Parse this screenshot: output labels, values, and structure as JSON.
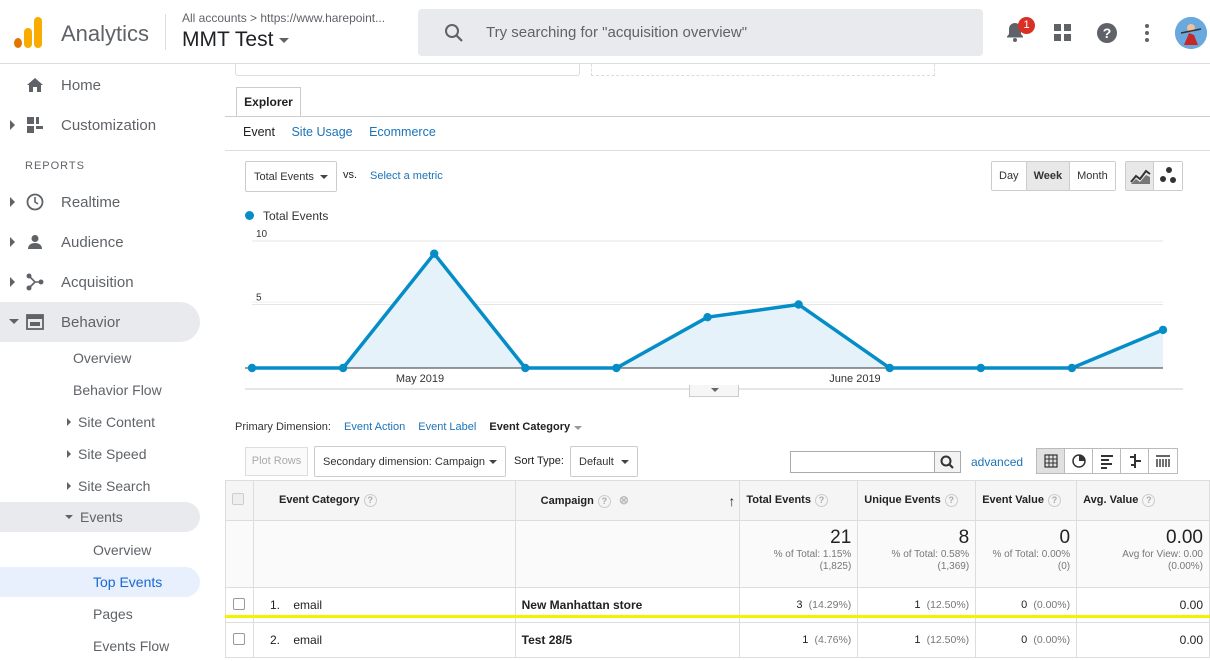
{
  "header": {
    "app_name": "Analytics",
    "breadcrumb": "All accounts > https://www.harepoint...",
    "property": "MMT Test",
    "search_placeholder": "Try searching for \"acquisition overview\"",
    "notification_count": "1"
  },
  "sidebar": {
    "items": [
      {
        "label": "Home"
      },
      {
        "label": "Customization"
      }
    ],
    "section_label": "REPORTS",
    "reports": [
      {
        "label": "Realtime"
      },
      {
        "label": "Audience"
      },
      {
        "label": "Acquisition"
      },
      {
        "label": "Behavior"
      }
    ],
    "behavior_sub": [
      {
        "label": "Overview"
      },
      {
        "label": "Behavior Flow"
      },
      {
        "label": "Site Content"
      },
      {
        "label": "Site Speed"
      },
      {
        "label": "Site Search"
      },
      {
        "label": "Events"
      }
    ],
    "events_sub": [
      {
        "label": "Overview"
      },
      {
        "label": "Top Events"
      },
      {
        "label": "Pages"
      },
      {
        "label": "Events Flow"
      }
    ]
  },
  "explorer": {
    "tab": "Explorer",
    "subtabs": [
      "Event",
      "Site Usage",
      "Ecommerce"
    ],
    "metric": "Total Events",
    "vs": "vs.",
    "select_metric": "Select a metric",
    "period_buttons": [
      "Day",
      "Week",
      "Month"
    ],
    "active_period": "Week"
  },
  "chart_data": {
    "type": "line",
    "series": [
      {
        "name": "Total Events",
        "values": [
          0,
          0,
          9,
          0,
          0,
          4,
          5,
          0,
          0,
          0,
          3
        ]
      }
    ],
    "x_tick_labels": [
      "May 2019",
      "June 2019"
    ],
    "y_ticks": [
      10,
      5
    ],
    "ylim": [
      0,
      10
    ],
    "color": "#058dc7",
    "grid": true
  },
  "dimensions": {
    "label": "Primary Dimension:",
    "options": [
      "Event Action",
      "Event Label",
      "Event Category"
    ],
    "active": "Event Category"
  },
  "table_toolbar": {
    "plot_rows": "Plot Rows",
    "secondary": "Secondary dimension: Campaign",
    "sort_label": "Sort Type:",
    "sort_value": "Default",
    "advanced": "advanced"
  },
  "table": {
    "headers": [
      "Event Category",
      "Campaign",
      "Total Events",
      "Unique Events",
      "Event Value",
      "Avg. Value"
    ],
    "totals": {
      "total_events": "21",
      "total_events_sub1": "% of Total: 1.15%",
      "total_events_sub2": "(1,825)",
      "unique_events": "8",
      "unique_events_sub1": "% of Total: 0.58%",
      "unique_events_sub2": "(1,369)",
      "event_value": "0",
      "event_value_sub1": "% of Total: 0.00%",
      "event_value_sub2": "(0)",
      "avg_value": "0.00",
      "avg_value_sub1": "Avg for View: 0.00",
      "avg_value_sub2": "(0.00%)"
    },
    "rows": [
      {
        "num": "1.",
        "category": "email",
        "campaign": "New Manhattan store",
        "total": "3",
        "total_pct": "(14.29%)",
        "unique": "1",
        "unique_pct": "(12.50%)",
        "value": "0",
        "value_pct": "(0.00%)",
        "avg": "0.00"
      },
      {
        "num": "2.",
        "category": "email",
        "campaign": "Test 28/5",
        "total": "1",
        "total_pct": "(4.76%)",
        "unique": "1",
        "unique_pct": "(12.50%)",
        "value": "0",
        "value_pct": "(0.00%)",
        "avg": "0.00"
      }
    ]
  }
}
